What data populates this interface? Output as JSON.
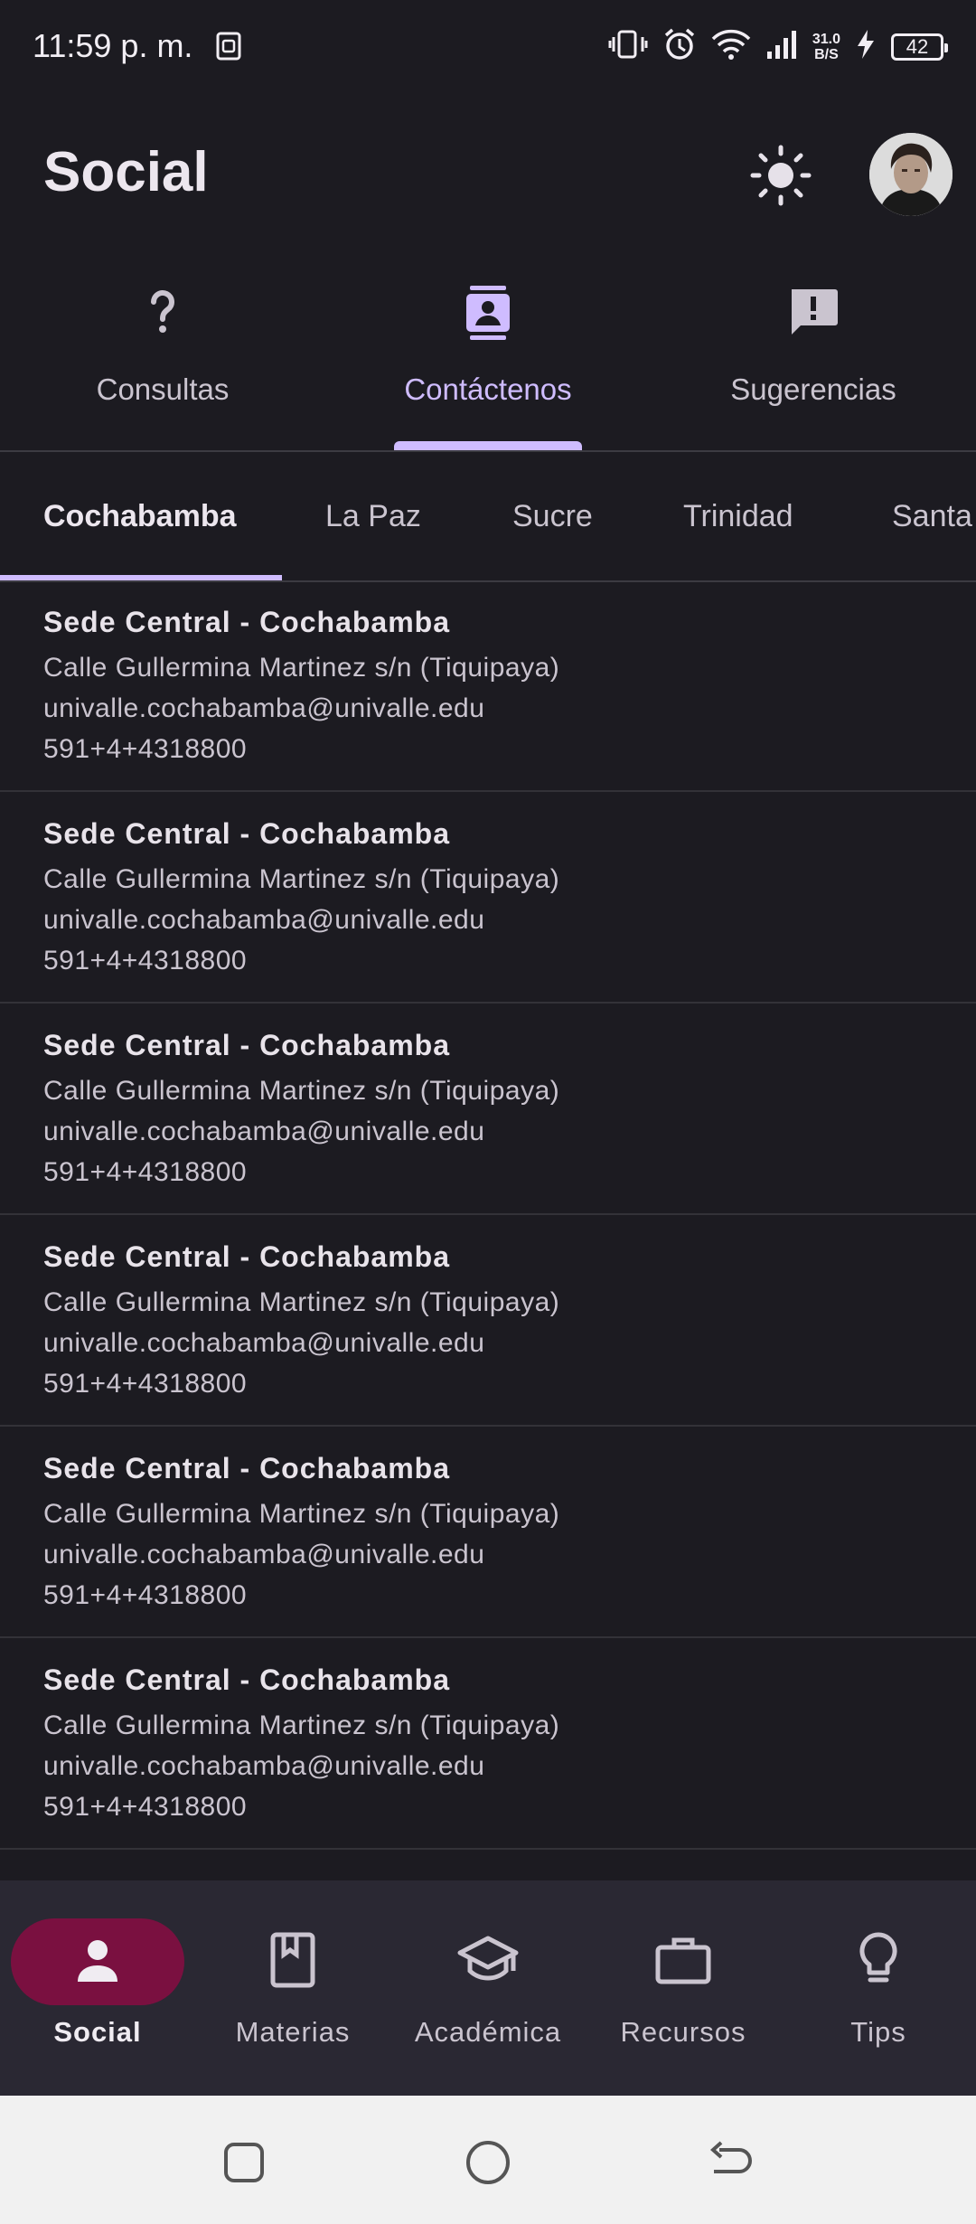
{
  "status_bar": {
    "time": "11:59 p. m.",
    "speed_value": "31.0",
    "speed_unit": "B/S",
    "battery": "42"
  },
  "app_bar": {
    "title": "Social"
  },
  "primary_tabs": [
    {
      "label": "Consultas",
      "icon": "question-mark-icon",
      "active": false
    },
    {
      "label": "Contáctenos",
      "icon": "contact-card-icon",
      "active": true
    },
    {
      "label": "Sugerencias",
      "icon": "feedback-icon",
      "active": false
    }
  ],
  "city_tabs": [
    {
      "label": "Cochabamba",
      "active": true
    },
    {
      "label": "La Paz",
      "active": false
    },
    {
      "label": "Sucre",
      "active": false
    },
    {
      "label": "Trinidad",
      "active": false
    },
    {
      "label": "Santa",
      "active": false
    }
  ],
  "contacts": [
    {
      "name": "Sede Central - Cochabamba",
      "address": "Calle Gullermina Martinez s/n (Tiquipaya)",
      "email": "univalle.cochabamba@univalle.edu",
      "phone": "591+4+4318800"
    },
    {
      "name": "Sede Central - Cochabamba",
      "address": "Calle Gullermina Martinez s/n (Tiquipaya)",
      "email": "univalle.cochabamba@univalle.edu",
      "phone": "591+4+4318800"
    },
    {
      "name": "Sede Central - Cochabamba",
      "address": "Calle Gullermina Martinez s/n (Tiquipaya)",
      "email": "univalle.cochabamba@univalle.edu",
      "phone": "591+4+4318800"
    },
    {
      "name": "Sede Central - Cochabamba",
      "address": "Calle Gullermina Martinez s/n (Tiquipaya)",
      "email": "univalle.cochabamba@univalle.edu",
      "phone": "591+4+4318800"
    },
    {
      "name": "Sede Central - Cochabamba",
      "address": "Calle Gullermina Martinez s/n (Tiquipaya)",
      "email": "univalle.cochabamba@univalle.edu",
      "phone": "591+4+4318800"
    },
    {
      "name": "Sede Central - Cochabamba",
      "address": "Calle Gullermina Martinez s/n (Tiquipaya)",
      "email": "univalle.cochabamba@univalle.edu",
      "phone": "591+4+4318800"
    }
  ],
  "bottom_nav": [
    {
      "label": "Social",
      "icon": "person-icon",
      "active": true
    },
    {
      "label": "Materias",
      "icon": "book-icon",
      "active": false
    },
    {
      "label": "Académica",
      "icon": "graduation-cap-icon",
      "active": false
    },
    {
      "label": "Recursos",
      "icon": "briefcase-icon",
      "active": false
    },
    {
      "label": "Tips",
      "icon": "lightbulb-icon",
      "active": false
    }
  ],
  "colors": {
    "background": "#1c1b21",
    "accent": "#cfbcff",
    "nav_active_pill": "#7a1040",
    "bottom_nav_bg": "#2a2833"
  }
}
